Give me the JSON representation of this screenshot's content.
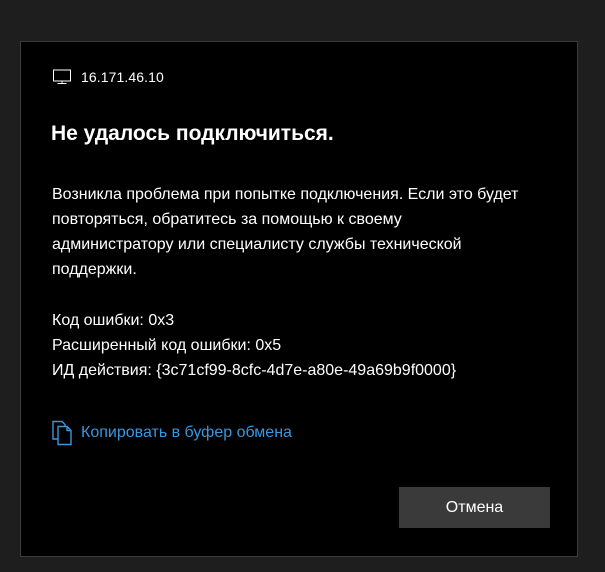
{
  "dialog": {
    "host_icon": "computer-monitor-icon",
    "host": "16.171.46.10",
    "title": "Не удалось подключиться.",
    "message": "Возникла проблема при попытке подключения. Если это будет повторяться, обратитесь за помощью к своему администратору или специалисту службы технической поддержки.",
    "error_code": "Код ошибки: 0x3",
    "extended_error_code": "Расширенный код ошибки: 0x5",
    "activity_id": "ИД действия: {3c71cf99-8cfc-4d7e-a80e-49a69b9f0000}",
    "copy_icon": "copy-icon",
    "copy_label": "Копировать в буфер обмена",
    "cancel_label": "Отмена"
  },
  "colors": {
    "page_background": "#1e1e1e",
    "dialog_background": "#000000",
    "dialog_border": "#3c3c3c",
    "link": "#3a96dd",
    "button_background": "#3a3a3a",
    "text": "#ffffff"
  }
}
